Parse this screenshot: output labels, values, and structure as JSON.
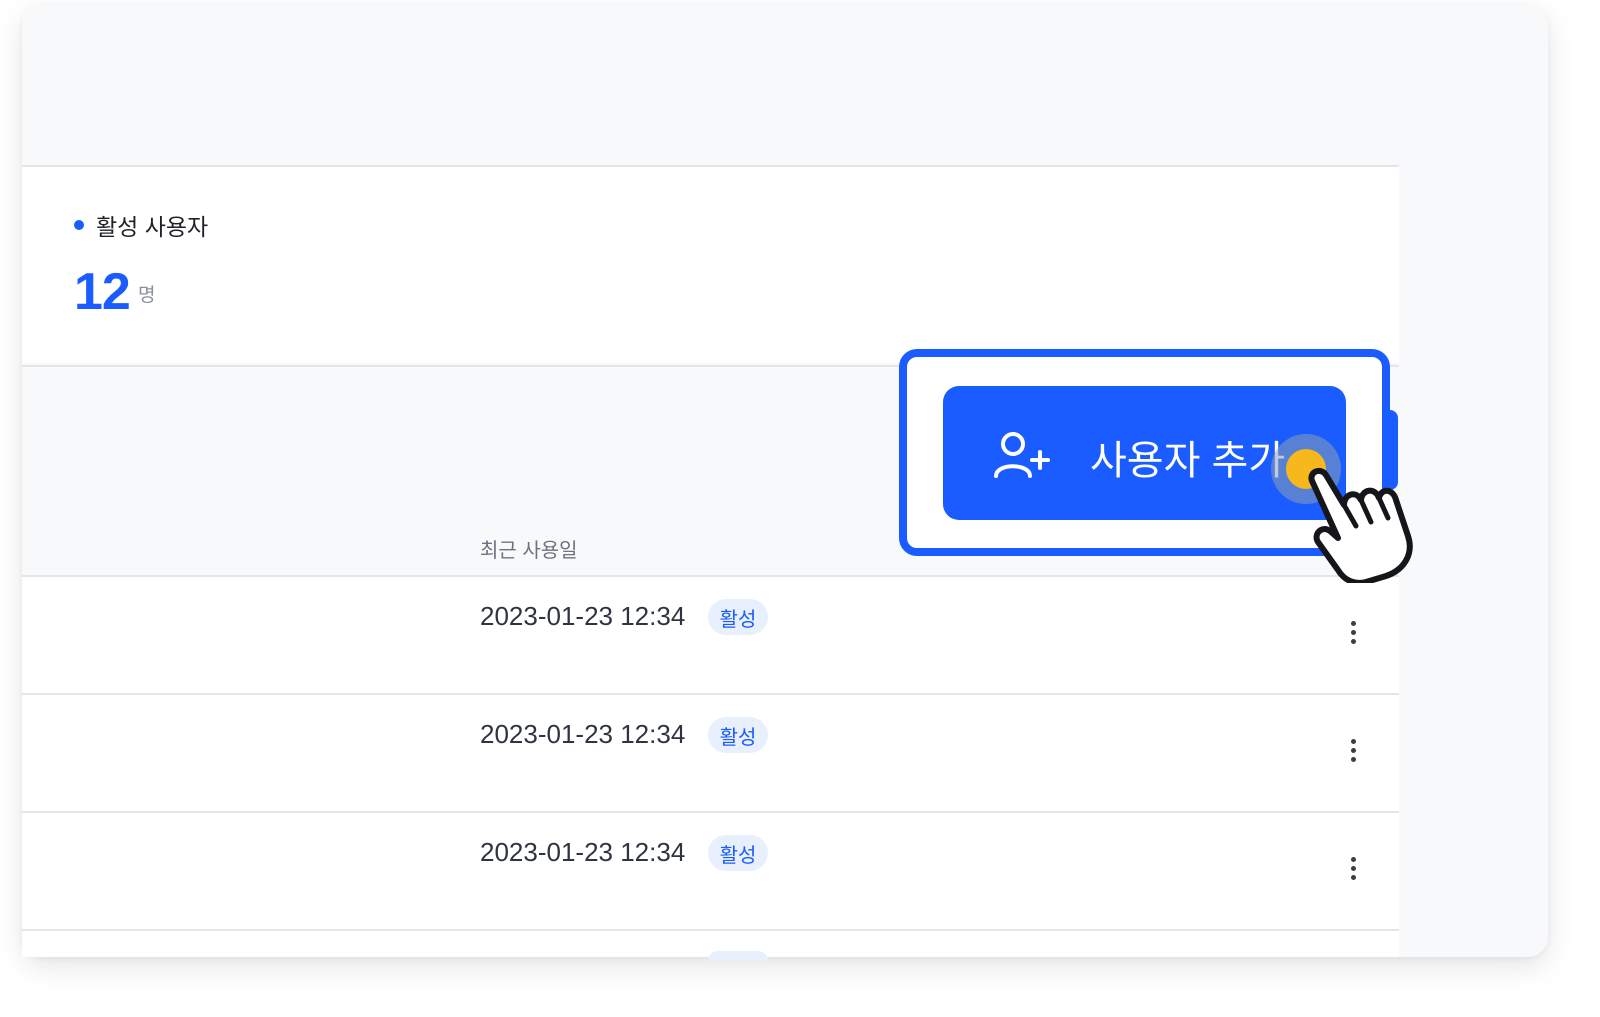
{
  "stat": {
    "label": "활성 사용자",
    "value": "12",
    "unit": "명"
  },
  "table": {
    "column_header": "최근 사용일",
    "rows": [
      {
        "date": "2023-01-23 12:34",
        "status": "활성"
      },
      {
        "date": "2023-01-23 12:34",
        "status": "활성"
      },
      {
        "date": "2023-01-23 12:34",
        "status": "활성"
      }
    ]
  },
  "action": {
    "add_user_label": "사용자 추가",
    "icon": "user-plus-icon"
  },
  "colors": {
    "accent": "#1a5cff",
    "badge_bg": "#e8f0fe",
    "tap_highlight": "#f6b81c"
  }
}
